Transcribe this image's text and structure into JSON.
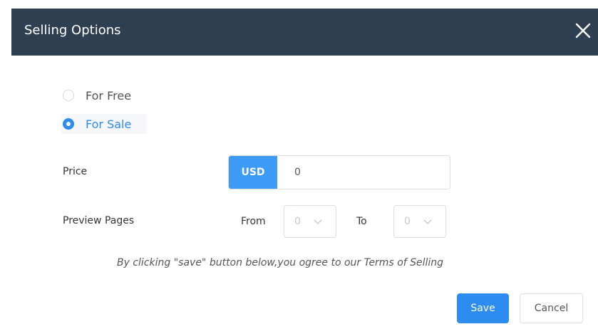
{
  "dialog": {
    "title": "Selling Options",
    "close_icon": "close-icon"
  },
  "selling_type": {
    "options": [
      {
        "label": "For Free",
        "selected": false
      },
      {
        "label": "For Sale",
        "selected": true
      }
    ]
  },
  "price": {
    "label": "Price",
    "currency": "USD",
    "value": "0"
  },
  "preview_pages": {
    "label": "Preview Pages",
    "from_label": "From",
    "from_value": "0",
    "to_label": "To",
    "to_value": "0",
    "arrow_icon": "chevron-down-icon"
  },
  "terms_text": "By clicking \"save\" button below,you ogree to our Terms of Selling",
  "buttons": {
    "save": "Save",
    "cancel": "Cancel"
  },
  "colors": {
    "header_bg": "#2f3f52",
    "accent": "#2d8cf0",
    "currency_bg": "#3c9bf4"
  }
}
